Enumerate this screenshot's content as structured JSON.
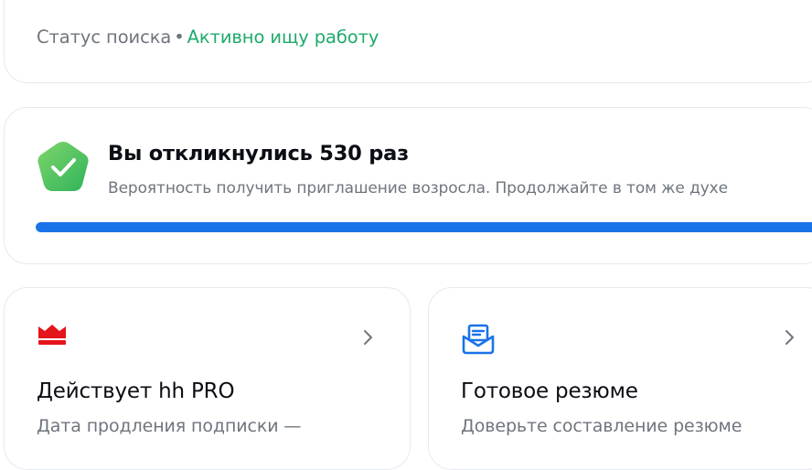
{
  "status": {
    "label": "Статус поиска",
    "separator": "•",
    "value": "Активно ищу работу",
    "value_color": "#1faa6b"
  },
  "responses": {
    "icon": "check-shield-icon",
    "title": "Вы откликнулись 530 раз",
    "subtitle": "Вероятность получить приглашение возросла. Продолжайте в том же духе",
    "progress_percent": 100,
    "progress_color": "#1a73e8"
  },
  "cards": [
    {
      "icon": "crown-icon",
      "icon_color": "#e3151a",
      "title": "Действует hh PRO",
      "subtitle": "Дата продления подписки —"
    },
    {
      "icon": "mail-envelope-icon",
      "icon_color": "#1a73e8",
      "title": "Готовое резюме",
      "subtitle": "Доверьте составление резюме"
    }
  ]
}
